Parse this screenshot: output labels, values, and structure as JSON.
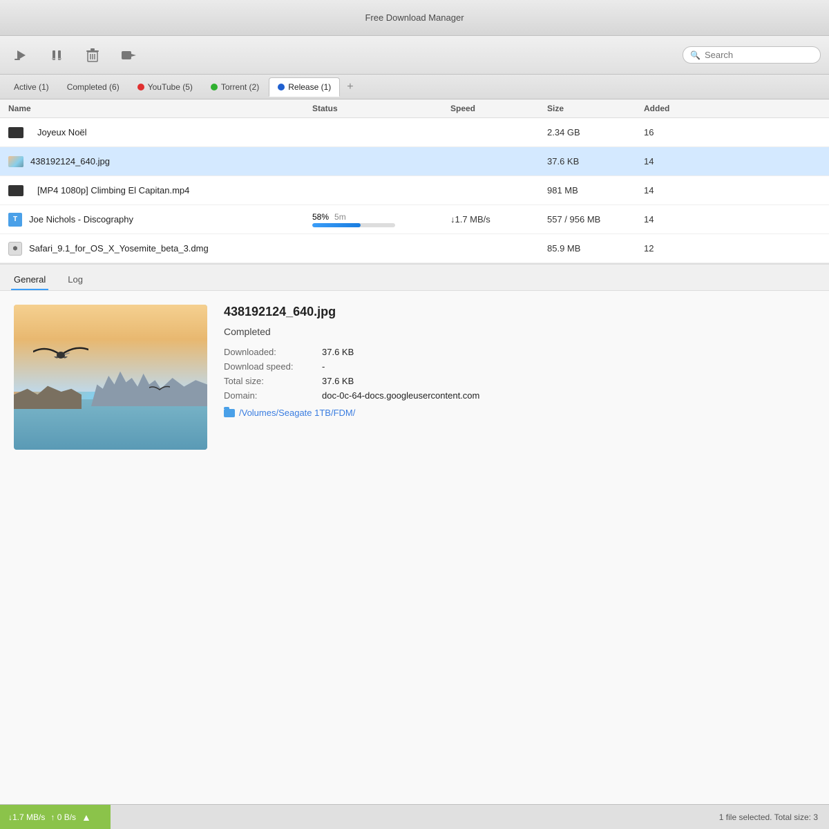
{
  "app": {
    "title": "Free Download Manager"
  },
  "toolbar": {
    "play_label": "▶",
    "pause_label": "⏸",
    "delete_label": "🗑",
    "move_label": "➡",
    "search_placeholder": "Search"
  },
  "tabs": [
    {
      "id": "active",
      "label": "Active (1)",
      "active": false,
      "dot": null
    },
    {
      "id": "completed",
      "label": "Completed (6)",
      "active": false,
      "dot": null
    },
    {
      "id": "youtube",
      "label": "YouTube (5)",
      "active": false,
      "dot": "red"
    },
    {
      "id": "torrent",
      "label": "Torrent (2)",
      "active": false,
      "dot": "green"
    },
    {
      "id": "release",
      "label": "Release (1)",
      "active": true,
      "dot": "blue"
    },
    {
      "id": "add",
      "label": "+",
      "active": false,
      "dot": null
    }
  ],
  "columns": {
    "name": "Name",
    "status": "Status",
    "speed": "Speed",
    "size": "Size",
    "added": "Added"
  },
  "files": [
    {
      "id": 1,
      "name": "Joyeux Noël",
      "icon": "video",
      "status": "",
      "speed": "",
      "size": "2.34 GB",
      "added": "16",
      "selected": false
    },
    {
      "id": 2,
      "name": "438192124_640.jpg",
      "icon": "image",
      "status": "",
      "speed": "",
      "size": "37.6 KB",
      "added": "14",
      "selected": true
    },
    {
      "id": 3,
      "name": "[MP4 1080p] Climbing El Capitan.mp4",
      "icon": "video",
      "status": "",
      "speed": "",
      "size": "981 MB",
      "added": "14",
      "selected": false
    },
    {
      "id": 4,
      "name": "Joe Nichols - Discography",
      "icon": "torrent",
      "status_text": "58%",
      "time_remaining": "5m",
      "speed": "↓1.7 MB/s",
      "progress": 58,
      "size": "557 / 956 MB",
      "added": "14",
      "selected": false
    },
    {
      "id": 5,
      "name": "Safari_9.1_for_OS_X_Yosemite_beta_3.dmg",
      "icon": "dmg",
      "status": "",
      "speed": "",
      "size": "85.9 MB",
      "added": "12",
      "selected": false
    }
  ],
  "detail": {
    "tabs": [
      "General",
      "Log"
    ],
    "active_tab": "General",
    "filename": "438192124_640.jpg",
    "status": "Completed",
    "downloaded_label": "Downloaded:",
    "downloaded_value": "37.6 KB",
    "speed_label": "Download speed:",
    "speed_value": "-",
    "size_label": "Total size:",
    "size_value": "37.6 KB",
    "domain_label": "Domain:",
    "domain_value": "doc-0c-64-docs.googleusercontent.com",
    "path_label": "/Volumes/Seagate 1TB/FDM/"
  },
  "statusbar": {
    "down_speed": "↓1.7 MB/s",
    "up_speed": "↑ 0 B/s",
    "selected_info": "1 file selected. Total size: 3"
  }
}
